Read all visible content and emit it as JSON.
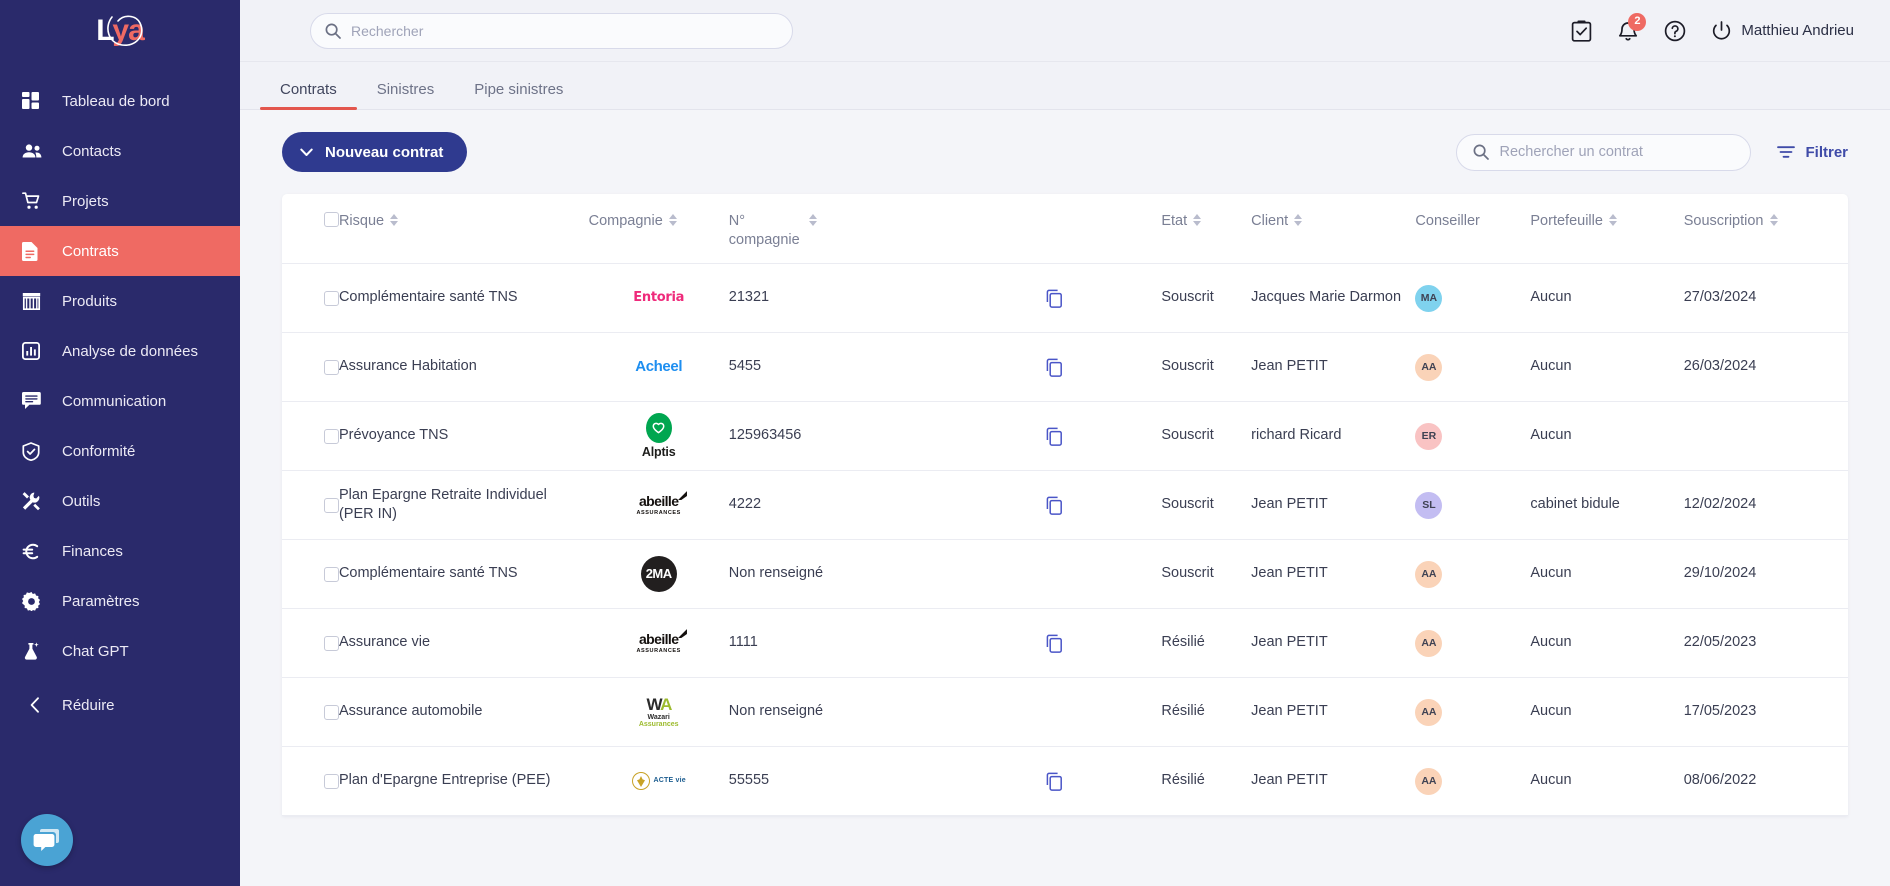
{
  "brand": {
    "name": "Lya",
    "accent": "#ef6a63",
    "sidebar_bg": "#2a2a6b",
    "primary": "#2f3a8f"
  },
  "sidebar": {
    "items": [
      {
        "label": "Tableau de bord",
        "icon": "dashboard-icon",
        "active": false
      },
      {
        "label": "Contacts",
        "icon": "contacts-icon",
        "active": false
      },
      {
        "label": "Projets",
        "icon": "cart-icon",
        "active": false
      },
      {
        "label": "Contrats",
        "icon": "document-icon",
        "active": true
      },
      {
        "label": "Produits",
        "icon": "store-icon",
        "active": false
      },
      {
        "label": "Analyse de données",
        "icon": "chart-icon",
        "active": false
      },
      {
        "label": "Communication",
        "icon": "message-icon",
        "active": false
      },
      {
        "label": "Conformité",
        "icon": "shield-check-icon",
        "active": false
      },
      {
        "label": "Outils",
        "icon": "tools-icon",
        "active": false
      },
      {
        "label": "Finances",
        "icon": "euro-icon",
        "active": false
      },
      {
        "label": "Paramètres",
        "icon": "gear-icon",
        "active": false
      },
      {
        "label": "Chat GPT",
        "icon": "flask-sparkle-icon",
        "active": false
      }
    ],
    "collapse_label": "Réduire",
    "chat_widget": "chat-bubble-icon"
  },
  "topbar": {
    "search_placeholder": "Rechercher",
    "search_value": "",
    "icons": [
      {
        "name": "clipboard-check-icon"
      },
      {
        "name": "bell-icon",
        "badge": "2"
      },
      {
        "name": "help-circle-icon"
      }
    ],
    "user": {
      "name": "Matthieu Andrieu",
      "icon": "power-icon"
    }
  },
  "tabs": [
    {
      "label": "Contrats",
      "active": true
    },
    {
      "label": "Sinistres",
      "active": false
    },
    {
      "label": "Pipe sinistres",
      "active": false
    }
  ],
  "toolbar": {
    "new_contract_label": "Nouveau contrat",
    "new_contract_icon": "chevron-down-icon",
    "search_placeholder": "Rechercher un contrat",
    "search_value": "",
    "filter_label": "Filtrer",
    "filter_icon": "filter-icon"
  },
  "table": {
    "columns": [
      {
        "key": "select",
        "label": "",
        "sortable": false
      },
      {
        "key": "risque",
        "label": "Risque",
        "sortable": true
      },
      {
        "key": "compagnie",
        "label": "Compagnie",
        "sortable": true
      },
      {
        "key": "num_compagnie",
        "label": "N° compagnie",
        "sortable": true
      },
      {
        "key": "copy",
        "label": "",
        "sortable": false
      },
      {
        "key": "etat",
        "label": "Etat",
        "sortable": true
      },
      {
        "key": "client",
        "label": "Client",
        "sortable": true
      },
      {
        "key": "conseiller",
        "label": "Conseiller",
        "sortable": false
      },
      {
        "key": "portefeuille",
        "label": "Portefeuille",
        "sortable": true
      },
      {
        "key": "souscription",
        "label": "Souscription",
        "sortable": true
      }
    ],
    "rows": [
      {
        "risque": "Complémentaire santé TNS",
        "compagnie": "Entoria",
        "compagnie_logo": "entoria",
        "num_compagnie": "21321",
        "has_copy": true,
        "etat": "Souscrit",
        "client": "Jacques Marie Darmon",
        "conseiller_initials": "MA",
        "conseiller_color": "#7fd2ee",
        "portefeuille": "Aucun",
        "souscription": "27/03/2024"
      },
      {
        "risque": "Assurance Habitation",
        "compagnie": "Acheel",
        "compagnie_logo": "acheel",
        "num_compagnie": "5455",
        "has_copy": true,
        "etat": "Souscrit",
        "client": "Jean PETIT",
        "conseiller_initials": "AA",
        "conseiller_color": "#fad3b8",
        "portefeuille": "Aucun",
        "souscription": "26/03/2024"
      },
      {
        "risque": "Prévoyance TNS",
        "compagnie": "Alptis",
        "compagnie_logo": "alptis",
        "num_compagnie": "125963456",
        "has_copy": true,
        "etat": "Souscrit",
        "client": "richard Ricard",
        "conseiller_initials": "ER",
        "conseiller_color": "#f9c3c3",
        "portefeuille": "Aucun",
        "souscription": ""
      },
      {
        "risque": "Plan Epargne Retraite Individuel (PER IN)",
        "compagnie": "abeille ASSURANCES",
        "compagnie_logo": "abeille",
        "num_compagnie": "4222",
        "has_copy": true,
        "etat": "Souscrit",
        "client": "Jean PETIT",
        "conseiller_initials": "SL",
        "conseiller_color": "#c3bdf2",
        "portefeuille": "cabinet bidule",
        "souscription": "12/02/2024"
      },
      {
        "risque": "Complémentaire santé TNS",
        "compagnie": "2MA",
        "compagnie_logo": "2ma",
        "num_compagnie": "Non renseigné",
        "has_copy": false,
        "etat": "Souscrit",
        "client": "Jean PETIT",
        "conseiller_initials": "AA",
        "conseiller_color": "#fad3b8",
        "portefeuille": "Aucun",
        "souscription": "29/10/2024"
      },
      {
        "risque": "Assurance vie",
        "compagnie": "abeille ASSURANCES",
        "compagnie_logo": "abeille",
        "num_compagnie": "1111",
        "has_copy": true,
        "etat": "Résilié",
        "client": "Jean PETIT",
        "conseiller_initials": "AA",
        "conseiller_color": "#fad3b8",
        "portefeuille": "Aucun",
        "souscription": "22/05/2023"
      },
      {
        "risque": "Assurance automobile",
        "compagnie": "Wazari Assurances",
        "compagnie_logo": "wazari",
        "num_compagnie": "Non renseigné",
        "has_copy": false,
        "etat": "Résilié",
        "client": "Jean PETIT",
        "conseiller_initials": "AA",
        "conseiller_color": "#fad3b8",
        "portefeuille": "Aucun",
        "souscription": "17/05/2023"
      },
      {
        "risque": "Plan d'Epargne Entreprise (PEE)",
        "compagnie": "ACTE vie",
        "compagnie_logo": "actevie",
        "num_compagnie": "55555",
        "has_copy": true,
        "etat": "Résilié",
        "client": "Jean PETIT",
        "conseiller_initials": "AA",
        "conseiller_color": "#fad3b8",
        "portefeuille": "Aucun",
        "souscription": "08/06/2022"
      }
    ]
  }
}
